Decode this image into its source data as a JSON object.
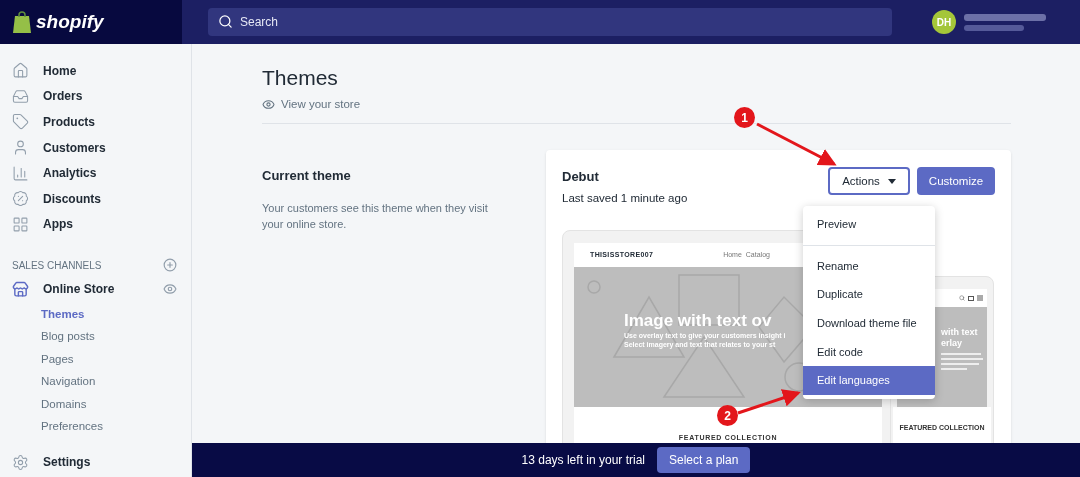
{
  "header": {
    "logo": "shopify",
    "search": {
      "placeholder": "Search"
    },
    "avatar": {
      "initials": "DH"
    }
  },
  "sidebar": {
    "items": [
      {
        "label": "Home"
      },
      {
        "label": "Orders"
      },
      {
        "label": "Products"
      },
      {
        "label": "Customers"
      },
      {
        "label": "Analytics"
      },
      {
        "label": "Discounts"
      },
      {
        "label": "Apps"
      }
    ],
    "sales_channels": {
      "title": "SALES CHANNELS",
      "channel": {
        "label": "Online Store",
        "subitems": [
          {
            "label": "Themes",
            "selected": true
          },
          {
            "label": "Blog posts",
            "selected": false
          },
          {
            "label": "Pages",
            "selected": false
          },
          {
            "label": "Navigation",
            "selected": false
          },
          {
            "label": "Domains",
            "selected": false
          },
          {
            "label": "Preferences",
            "selected": false
          }
        ]
      }
    },
    "settings": "Settings"
  },
  "page": {
    "title": "Themes",
    "view_link": "View your store",
    "section": {
      "title": "Current theme",
      "description": "Your customers see this theme when they visit your online store."
    },
    "theme": {
      "name": "Debut",
      "saved": "Last saved 1 minute ago",
      "actions": "Actions",
      "customize": "Customize",
      "menu": [
        {
          "label": "Preview",
          "selected": false,
          "divider_after": true
        },
        {
          "label": "Rename",
          "selected": false,
          "divider_after": false
        },
        {
          "label": "Duplicate",
          "selected": false,
          "divider_after": false
        },
        {
          "label": "Download theme file",
          "selected": false,
          "divider_after": false
        },
        {
          "label": "Edit code",
          "selected": false,
          "divider_after": false
        },
        {
          "label": "Edit languages",
          "selected": true,
          "divider_after": false
        }
      ],
      "preview": {
        "store_name": "THISISSTORE007",
        "nav": [
          "Home",
          "Catalog"
        ],
        "hero_title": "Image with text ov",
        "hero_lines": [
          "Use overlay text to give your customers insight i",
          "Select imagery and text that relates to your st"
        ],
        "featured": "FEATURED COLLECTION",
        "mobile": {
          "hero_title_lines": [
            "with text",
            "erlay"
          ],
          "featured": "FEATURED COLLECTION"
        }
      }
    }
  },
  "annotations": [
    {
      "number": "1"
    },
    {
      "number": "2"
    }
  ],
  "trial_bar": {
    "text": "13 days left in your trial",
    "button": "Select a plan"
  }
}
